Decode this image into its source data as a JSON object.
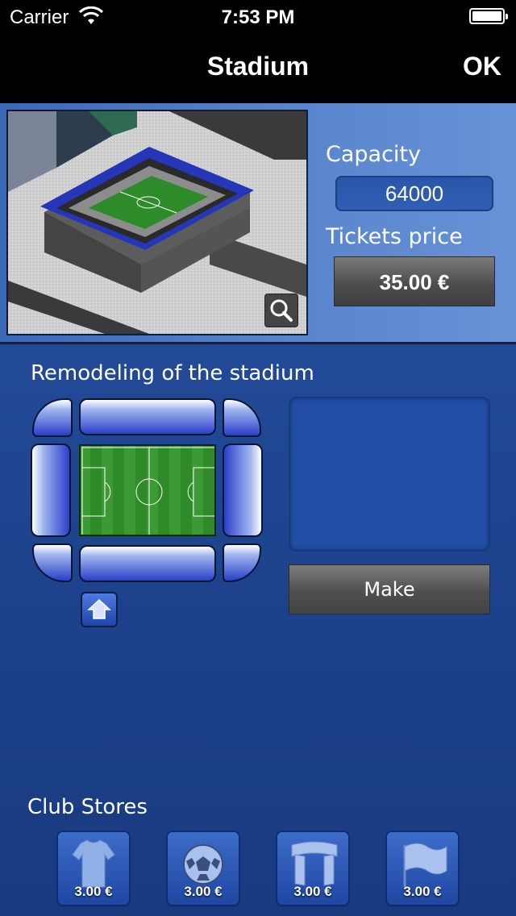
{
  "status_bar": {
    "carrier": "Carrier",
    "time": "7:53 PM"
  },
  "nav": {
    "title": "Stadium",
    "ok_label": "OK"
  },
  "stadium": {
    "capacity_label": "Capacity",
    "capacity_value": "64000",
    "tickets_price_label": "Tickets price",
    "tickets_price_value": "35.00 €"
  },
  "remodeling": {
    "title": "Remodeling of the stadium",
    "make_label": "Make"
  },
  "stores": {
    "title": "Club Stores",
    "items": [
      {
        "icon": "jersey-icon",
        "price": "3.00 €"
      },
      {
        "icon": "ball-icon",
        "price": "3.00 €"
      },
      {
        "icon": "scarf-icon",
        "price": "3.00 €"
      },
      {
        "icon": "flag-icon",
        "price": "3.00 €"
      }
    ]
  }
}
